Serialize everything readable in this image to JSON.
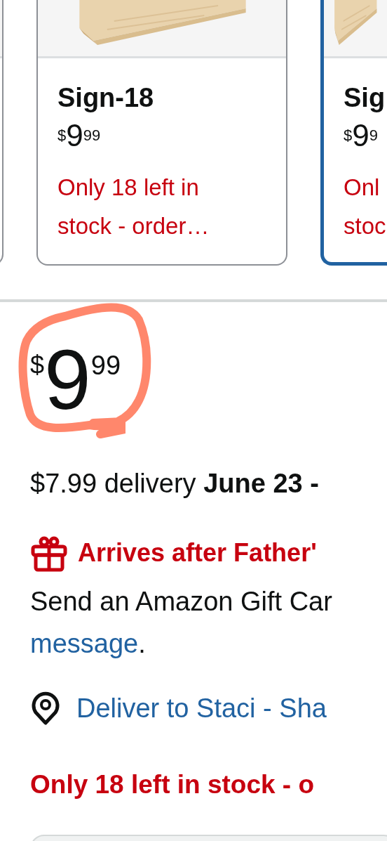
{
  "variants": [
    {
      "selected": false
    },
    {
      "title": "Sign-18",
      "currency": "$",
      "whole": "9",
      "fraction": "99",
      "stock": "Only 18 left in stock - order…",
      "selected": false
    },
    {
      "title": "Sig",
      "currency": "$",
      "whole": "9",
      "fraction": "9",
      "stock": "Onl stoc",
      "selected": true
    }
  ],
  "price": {
    "currency": "$",
    "whole": "9",
    "fraction": "99",
    "circled": true
  },
  "delivery": "$7.99 delivery **June 23 -**",
  "gift_alert": "Arrives after Father'",
  "gift_note": {
    "text": "Send an Amazon Gift Car",
    "link": "message",
    "end": "."
  },
  "deliver_to": "Deliver to Staci - Sha",
  "stock": "Only 18 left in stock - o"
}
